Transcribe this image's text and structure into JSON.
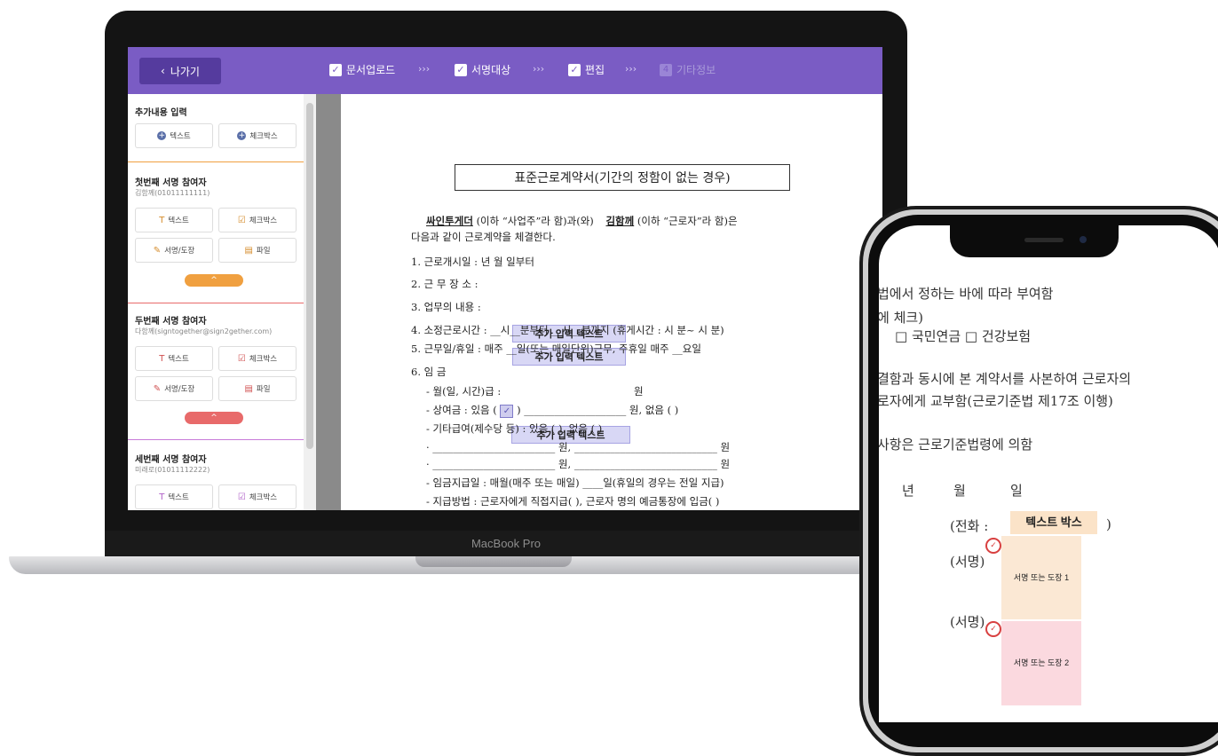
{
  "laptop": {
    "model_label": "MacBook Pro",
    "topbar": {
      "back_label": "나가기",
      "steps": [
        {
          "label": "문서업로드",
          "state": "done"
        },
        {
          "label": "서명대상",
          "state": "done"
        },
        {
          "label": "편집",
          "state": "done"
        },
        {
          "label": "기타정보",
          "state": "pending",
          "number": "4"
        }
      ],
      "separator": "›››"
    },
    "sidebar": {
      "add_section_title": "추가내용 입력",
      "add_text_label": "텍스트",
      "add_checkbox_label": "체크박스",
      "participants": [
        {
          "title": "첫번째 서명 참여자",
          "subtitle": "김함께(01011111111)",
          "text_label": "텍스트",
          "checkbox_label": "체크박스",
          "sign_label": "서명/도장",
          "file_label": "파일",
          "accent": "#f0a040"
        },
        {
          "title": "두번째 서명 참여자",
          "subtitle": "다함께(signtogether@sign2gether.com)",
          "text_label": "텍스트",
          "checkbox_label": "체크박스",
          "sign_label": "서명/도장",
          "file_label": "파일",
          "accent": "#e86a6a"
        },
        {
          "title": "세번째 서명 참여자",
          "subtitle": "미래로(01011112222)",
          "text_label": "텍스트",
          "checkbox_label": "체크박스"
        }
      ],
      "collapse_symbol": "^"
    },
    "document": {
      "title": "표준근로계약서(기간의 정함이 없는 경우)",
      "employer_name": "싸인투게더",
      "employer_suffix": "(이하 “사업주”라 함)과(와)",
      "employee_name": "김함께",
      "employee_suffix": "(이하 “근로자”라 함)은",
      "intro_line2": "다음과 같이 근로계약을 체결한다.",
      "item1": "1. 근로개시일 :     년   월   일부터",
      "item2_label": "2. 근 무 장 소 :",
      "item3_label": "3. 업무의 내용 :",
      "item4": "4. 소정근로시간 : __시__분부터 __시__분까지 (휴게시간 : 시 분~ 시  분)",
      "item5": "5. 근무일/휴일 : 매주 __일(또는 매일단위)근무, 주휴일 매주 __요일",
      "item6": "6. 임  금",
      "wage_label": "- 월(일, 시간)급 :",
      "wage_unit": "원",
      "bonus_prefix": "- 상여금 : 있음 (",
      "bonus_check": "✓",
      "bonus_suffix": ")  ____________________ 원,   없음 (     )",
      "other_pay": "- 기타급여(제수당 등) : 있음 (    ),    없음 (    )",
      "other_line1": "  · ________________________ 원,  ____________________________ 원",
      "other_line2": "  · ________________________ 원,  ____________________________ 원",
      "pay_day": "- 임금지급일 : 매월(매주 또는 매일) ____일(휴일의 경우는 전일 지급)",
      "pay_method": "- 지급방법 : 근로자에게 직접지급(    ),  근로자 명의 예금통장에 입금(    )",
      "field_placeholder": "추가 입력 텍스트"
    }
  },
  "phone": {
    "lines": [
      "법에서 정하는 바에 따라 부여함",
      "에 체크)",
      "□ 국민연금  □ 건강보험",
      "결함과 동시에 본 계약서를 사본하여 근로자의",
      "로자에게 교부함(근로기준법 제17조 이행)",
      "사항은 근로기준법령에 의함"
    ],
    "date_labels": [
      "년",
      "월",
      "일"
    ],
    "phone_label_prefix": "(전화 :",
    "phone_label_suffix": ")",
    "text_box_label": "텍스트 박스",
    "sign_label": "(서명)",
    "sign_box_1": "서명 또는 도장 1",
    "sign_box_2": "서명 또는 도장 2"
  },
  "colors": {
    "topbar": "#7a5cc4",
    "field_fill": "#d8d7f5",
    "sign_box_1": "#fbe8d4",
    "sign_box_2": "#fbd9df",
    "text_box": "#fbe3c8"
  }
}
